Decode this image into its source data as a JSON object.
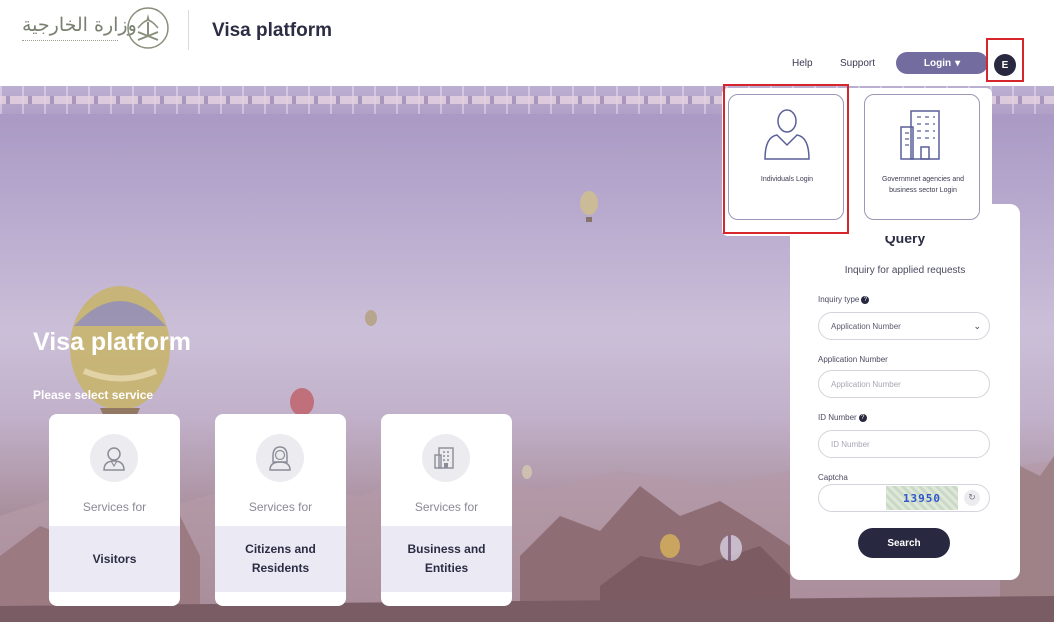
{
  "header": {
    "logo_text": "وزارة الخارجية",
    "title": "Visa platform",
    "nav": {
      "help": "Help",
      "support": "Support"
    },
    "login_label": "Login",
    "login_caret": "▾",
    "language_label": "E"
  },
  "hero": {
    "title": "Visa platform",
    "subtitle": "Please select service"
  },
  "services": [
    {
      "for": "Services for",
      "name": "Visitors",
      "icon": "person-icon"
    },
    {
      "for": "Services for",
      "name": "Citizens and Residents",
      "icon": "citizen-icon"
    },
    {
      "for": "Services for",
      "name": "Business and Entities",
      "icon": "building-icon"
    }
  ],
  "login_dropdown": {
    "individuals": "Individuals Login",
    "government": "Governmnet agencies and business sector Login"
  },
  "query": {
    "title": "Query",
    "subtitle": "Inquiry for applied requests",
    "inquiry_type_label": "Inquiry type",
    "inquiry_type_value": "Application Number",
    "application_number_label": "Application Number",
    "application_number_placeholder": "Application Number",
    "id_number_label": "ID Number",
    "id_number_placeholder": "ID Number",
    "captcha_label": "Captcha",
    "captcha_text": "13950",
    "search_label": "Search"
  },
  "colors": {
    "primary": "#726d9e",
    "dark": "#282840",
    "highlight": "#d6262c"
  }
}
